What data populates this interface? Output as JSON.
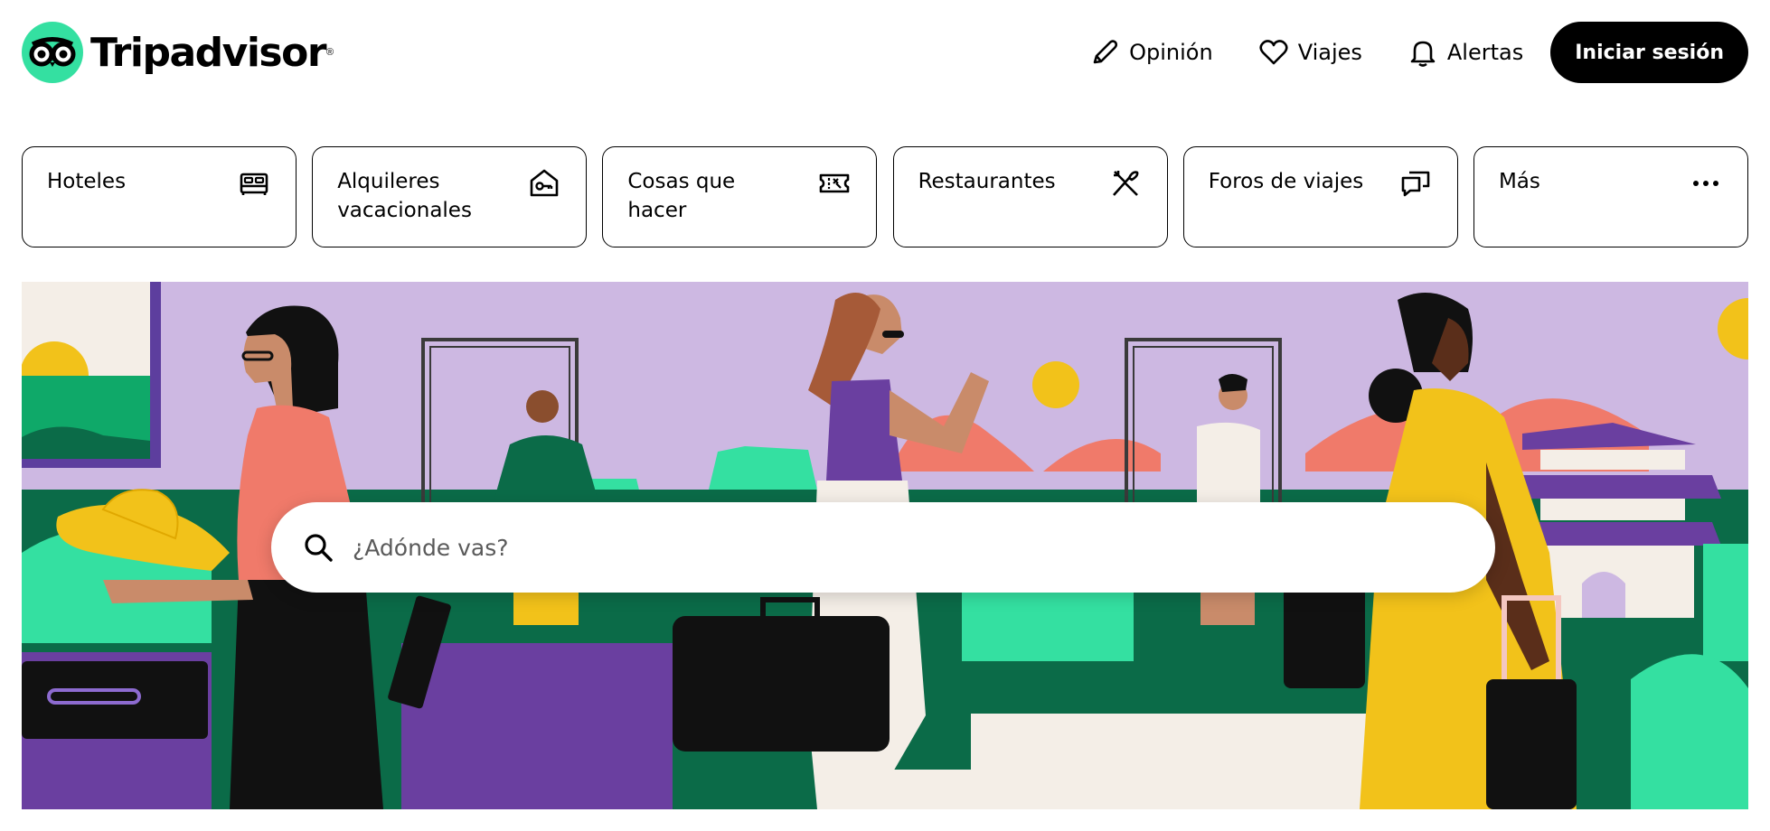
{
  "brand": {
    "name": "Tripadvisor",
    "accent_color": "#34e0a1",
    "registered_mark": "®"
  },
  "nav": {
    "review": {
      "label": "Opinión",
      "icon": "pencil-icon"
    },
    "trips": {
      "label": "Viajes",
      "icon": "heart-icon"
    },
    "alerts": {
      "label": "Alertas",
      "icon": "bell-icon"
    },
    "signin": {
      "label": "Iniciar sesión"
    }
  },
  "categories": [
    {
      "label": "Hoteles",
      "icon": "bed-icon"
    },
    {
      "label": "Alquileres vacacionales",
      "icon": "house-key-icon"
    },
    {
      "label": "Cosas que hacer",
      "icon": "ticket-icon"
    },
    {
      "label": "Restaurantes",
      "icon": "utensils-icon"
    },
    {
      "label": "Foros de viajes",
      "icon": "chat-bubbles-icon"
    },
    {
      "label": "Más",
      "icon": "more-dots-icon"
    }
  ],
  "search": {
    "placeholder": "¿Adónde vas?"
  },
  "hero": {
    "colors": {
      "background": "#cdb8e2",
      "green": "#34e0a1",
      "dark_green": "#0b6b48",
      "yellow": "#f2c21a",
      "coral": "#f07a6a",
      "purple": "#6a3fa0"
    }
  }
}
